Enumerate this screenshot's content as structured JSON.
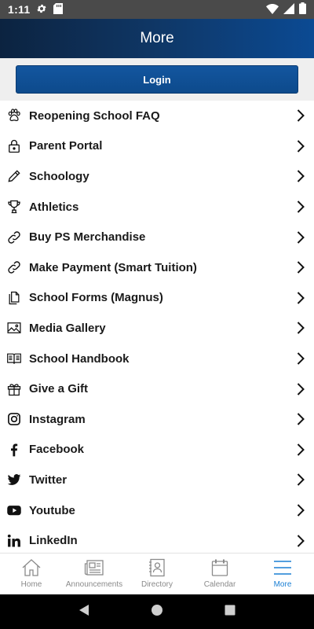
{
  "status_bar": {
    "time": "1:11"
  },
  "header": {
    "title": "More"
  },
  "login": {
    "label": "Login"
  },
  "menu": [
    {
      "label": "Reopening School FAQ",
      "icon": "paw-icon"
    },
    {
      "label": "Parent Portal",
      "icon": "lock-icon"
    },
    {
      "label": "Schoology",
      "icon": "pencil-icon"
    },
    {
      "label": "Athletics",
      "icon": "trophy-icon"
    },
    {
      "label": "Buy PS Merchandise",
      "icon": "link-icon"
    },
    {
      "label": "Make Payment (Smart Tuition)",
      "icon": "link-icon"
    },
    {
      "label": "School Forms (Magnus)",
      "icon": "documents-icon"
    },
    {
      "label": "Media Gallery",
      "icon": "image-icon"
    },
    {
      "label": "School Handbook",
      "icon": "book-icon"
    },
    {
      "label": "Give a Gift",
      "icon": "gift-icon"
    },
    {
      "label": "Instagram",
      "icon": "instagram-icon"
    },
    {
      "label": "Facebook",
      "icon": "facebook-icon"
    },
    {
      "label": "Twitter",
      "icon": "twitter-icon"
    },
    {
      "label": "Youtube",
      "icon": "youtube-icon"
    },
    {
      "label": "LinkedIn",
      "icon": "linkedin-icon"
    }
  ],
  "tabs": [
    {
      "label": "Home",
      "icon": "home-icon",
      "active": false
    },
    {
      "label": "Announcements",
      "icon": "newspaper-icon",
      "active": false
    },
    {
      "label": "Directory",
      "icon": "contacts-icon",
      "active": false
    },
    {
      "label": "Calendar",
      "icon": "calendar-icon",
      "active": false
    },
    {
      "label": "More",
      "icon": "menu-icon",
      "active": true
    }
  ],
  "colors": {
    "header_start": "#0c2340",
    "header_end": "#0b4a93",
    "login_button": "#13569f",
    "active_tab": "#1a7fd4",
    "inactive_tab": "#8a8a8a"
  }
}
